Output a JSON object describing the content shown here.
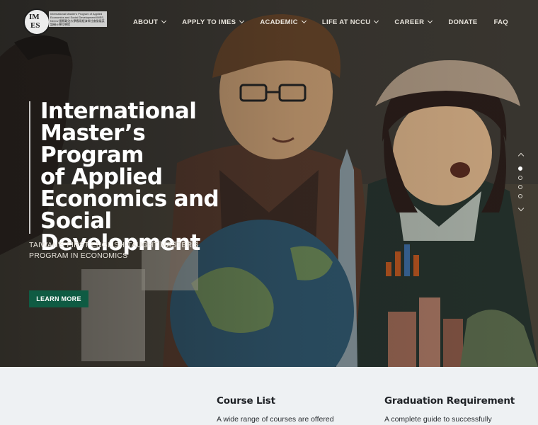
{
  "logo": {
    "monogram": [
      "IM",
      "ES"
    ],
    "text": "International Master's Program of Applied Economics and Social Development  IMES, NCCU  國際政治大學應用經濟與社會發展英語碩士學位學程"
  },
  "nav": {
    "items": [
      {
        "label": "ABOUT",
        "dropdown": true
      },
      {
        "label": "APPLY TO IMES",
        "dropdown": true
      },
      {
        "label": "ACADEMIC",
        "dropdown": true
      },
      {
        "label": "LIFE AT NCCU",
        "dropdown": true
      },
      {
        "label": "CAREER",
        "dropdown": true
      },
      {
        "label": "DONATE",
        "dropdown": false
      },
      {
        "label": "FAQ",
        "dropdown": false
      }
    ]
  },
  "hero": {
    "title_lines": [
      "International",
      "Master’s Program",
      "of Applied",
      "Economics and",
      "Social",
      "Development"
    ],
    "subtitle": "TAIWAN'S FIRST ENGLISH-TAUGHT MASTER'S PROGRAM IN ECONOMICS",
    "button_label": "LEARN MORE"
  },
  "slider": {
    "slide_count": 4,
    "active_index": 0
  },
  "cards": [
    {
      "title": "Course List",
      "text": "A wide range of courses are offered"
    },
    {
      "title": "Graduation Requirement",
      "text": "A complete guide to successfully"
    }
  ],
  "colors": {
    "accent": "#0f5b43",
    "lower_bg": "#eef1f3"
  }
}
